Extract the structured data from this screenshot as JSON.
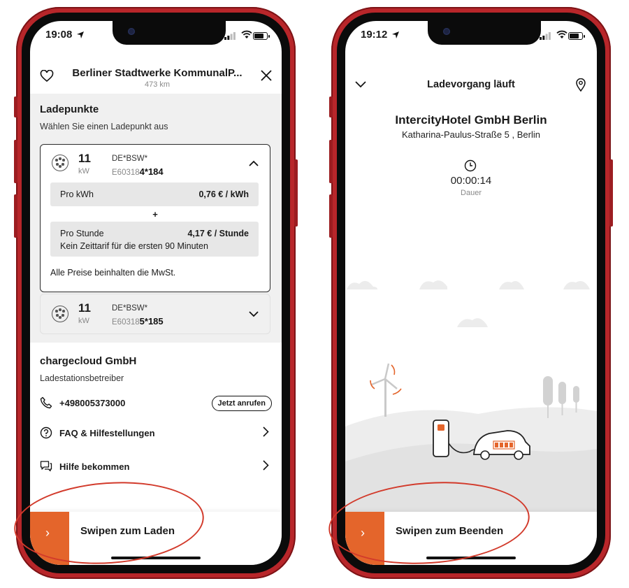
{
  "left": {
    "status_time": "19:08",
    "header": {
      "title": "Berliner Stadtwerke KommunalP...",
      "distance": "473 km"
    },
    "ladepunkte": {
      "title": "Ladepunkte",
      "subtitle": "Wählen Sie einen Ladepunkt aus",
      "points": [
        {
          "kw": "11",
          "unit": "kW",
          "evse_prefix": "DE*BSW*",
          "evse_id_prefix": "E603184",
          "evse_id_bold": "4*184"
        },
        {
          "kw": "11",
          "unit": "kW",
          "evse_prefix": "DE*BSW*",
          "evse_id_prefix": "E603185",
          "evse_id_bold": "5*185"
        }
      ],
      "price_kwh_label": "Pro kWh",
      "price_kwh_value": "0,76 € / kWh",
      "plus": "+",
      "price_hour_label": "Pro Stunde",
      "price_hour_value": "4,17 € / Stunde",
      "price_hour_note": "Kein Zeittarif für die ersten 90 Minuten",
      "vat_note": "Alle Preise beinhalten die MwSt."
    },
    "operator": {
      "name": "chargecloud GmbH",
      "role": "Ladestationsbetreiber"
    },
    "phone": "+498005373000",
    "call_button": "Jetzt anrufen",
    "faq": "FAQ & Hilfestellungen",
    "help": "Hilfe bekommen",
    "swipe_label": "Swipen zum Laden",
    "swipe_arrow": "›"
  },
  "right": {
    "status_time": "19:12",
    "header_title": "Ladevorgang läuft",
    "site_name": "IntercityHotel GmbH Berlin",
    "address": "Katharina-Paulus-Straße 5 , Berlin",
    "timer": "00:00:14",
    "timer_label": "Dauer",
    "swipe_label": "Swipen zum Beenden",
    "swipe_arrow": "›"
  },
  "colors": {
    "accent": "#e4652b",
    "phone_frame": "#b8262a",
    "annotation": "#d23a2b"
  }
}
